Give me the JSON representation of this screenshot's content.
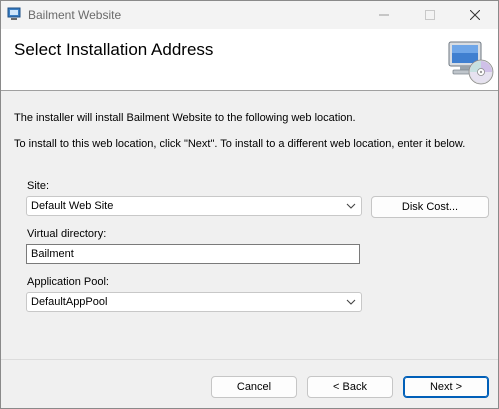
{
  "window": {
    "title": "Bailment Website"
  },
  "banner": {
    "title": "Select Installation Address",
    "icon": "computer-cd-icon"
  },
  "intro": {
    "line1": "The installer will install Bailment Website to the following web location.",
    "line2": "To install to this web location, click \"Next\". To install to a different web location, enter it below."
  },
  "fields": {
    "site": {
      "label": "Site:",
      "value": "Default Web Site"
    },
    "virtual_directory": {
      "label": "Virtual directory:",
      "value": "Bailment"
    },
    "app_pool": {
      "label": "Application Pool:",
      "value": "DefaultAppPool"
    }
  },
  "buttons": {
    "disk_cost": "Disk Cost...",
    "cancel": "Cancel",
    "back": "< Back",
    "next": "Next >"
  },
  "colors": {
    "accent": "#005fb8"
  }
}
